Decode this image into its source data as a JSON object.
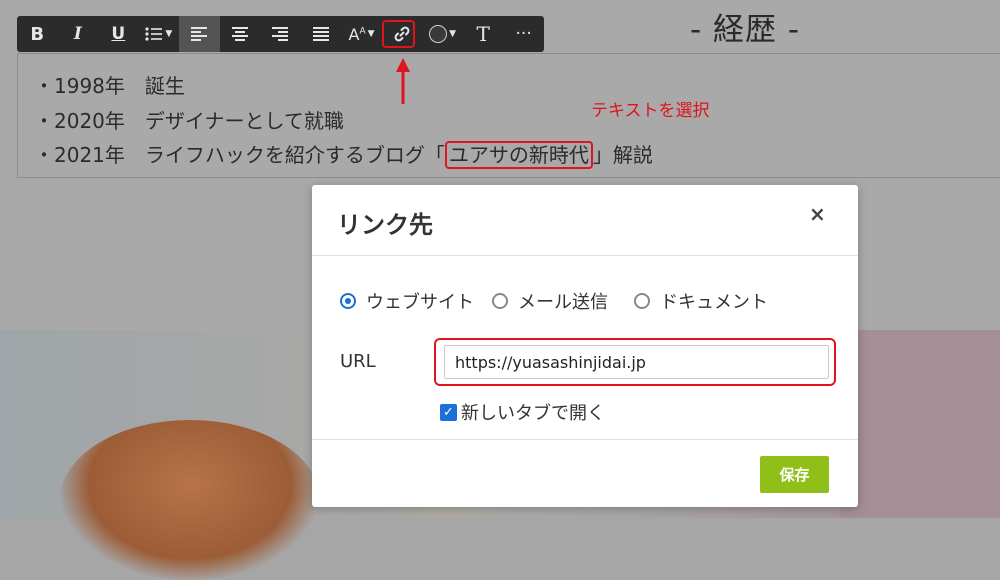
{
  "page": {
    "heading": "- 経歴 -"
  },
  "toolbar": {
    "bold": "B",
    "italic": "I",
    "underline": "U",
    "text_size": "Aᴬ",
    "text_style": "T",
    "more": "···",
    "active_item": "align-left",
    "highlighted_item": "link"
  },
  "editor": {
    "lines": [
      {
        "bullet": "・",
        "year": "1998年",
        "text": "誕生"
      },
      {
        "bullet": "・",
        "year": "2020年",
        "text": "デザイナーとして就職"
      },
      {
        "bullet": "・",
        "year": "2021年",
        "text_before": "ライフハックを紹介するブログ「",
        "selected": "ユアサの新時代",
        "text_after": "」解説"
      }
    ]
  },
  "annotation": {
    "label": "テキストを選択",
    "color": "#e0141e"
  },
  "dialog": {
    "title": "リンク先",
    "close": "×",
    "link_types": [
      {
        "label": "ウェブサイト",
        "selected": true
      },
      {
        "label": "メール送信",
        "selected": false
      },
      {
        "label": "ドキュメント",
        "selected": false
      }
    ],
    "url_label": "URL",
    "url_value": "https://yuasashinjidai.jp",
    "open_new_tab": {
      "label": "新しいタブで開く",
      "checked": true
    },
    "save_label": "保存"
  },
  "colors": {
    "accent_blue": "#1a6fd8",
    "save_green": "#8fbf18",
    "highlight_red": "#e0141e"
  }
}
